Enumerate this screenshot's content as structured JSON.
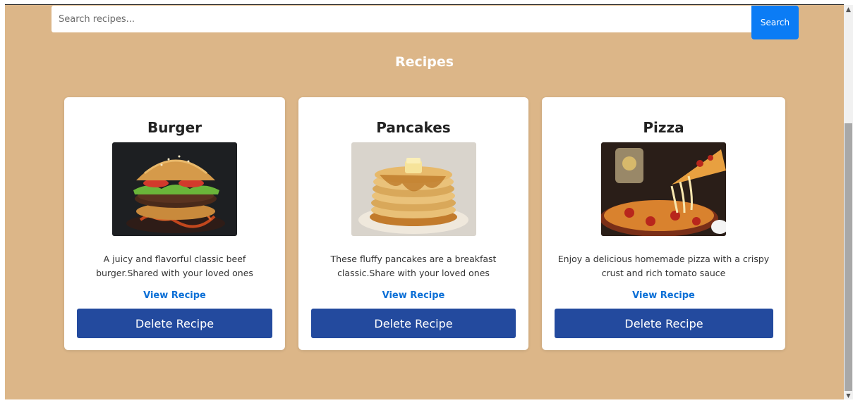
{
  "search": {
    "placeholder": "Search recipes...",
    "button_label": "Search"
  },
  "page": {
    "title": "Recipes"
  },
  "recipes": [
    {
      "title": "Burger",
      "image_icon": "burger-photo",
      "desc_line1": "A juicy and flavorful classic beef",
      "desc_line2": "burger.Shared with your loved ones",
      "view_label": "View Recipe",
      "delete_label": "Delete Recipe"
    },
    {
      "title": "Pancakes",
      "image_icon": "pancakes-photo",
      "desc_line1": "These fluffy pancakes are a breakfast",
      "desc_line2": "classic.Share with your loved ones",
      "view_label": "View Recipe",
      "delete_label": "Delete Recipe"
    },
    {
      "title": "Pizza",
      "image_icon": "pizza-photo",
      "desc_line1": "Enjoy a delicious homemade pizza with a crispy",
      "desc_line2": "crust and rich tomato sauce",
      "view_label": "View Recipe",
      "delete_label": "Delete Recipe"
    }
  ],
  "colors": {
    "background": "#dcb688",
    "search_button": "#0b7cf5",
    "delete_button": "#234a9e",
    "link": "#0b6fd6"
  }
}
